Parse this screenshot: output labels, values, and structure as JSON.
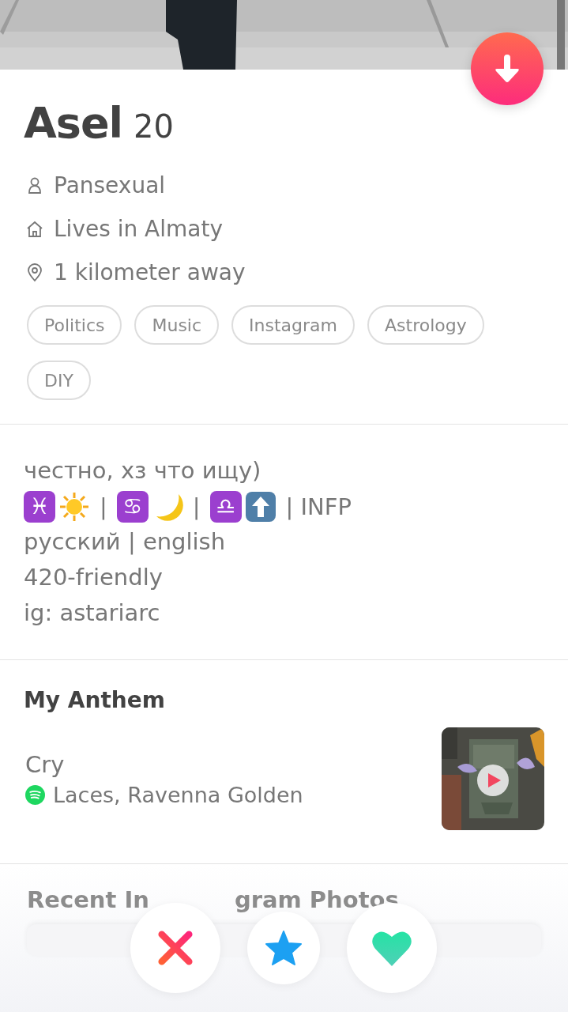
{
  "profile": {
    "name": "Asel",
    "age": "20"
  },
  "details": [
    {
      "kind": "orientation",
      "text": "Pansexual"
    },
    {
      "kind": "home",
      "text": "Lives in Almaty"
    },
    {
      "kind": "distance",
      "text": "1 kilometer away"
    }
  ],
  "interests": [
    "Politics",
    "Music",
    "Instagram",
    "Astrology",
    "DIY"
  ],
  "bio": [
    {
      "kind": "text",
      "text": "честно, хз что ищу)"
    },
    {
      "kind": "emoji_row",
      "parts": [
        {
          "kind": "sign",
          "text": "♓"
        },
        {
          "kind": "sun"
        },
        {
          "kind": "separator",
          "text": "|"
        },
        {
          "kind": "sign",
          "text": "♋"
        },
        {
          "kind": "moon"
        },
        {
          "kind": "separator",
          "text": "|"
        },
        {
          "kind": "sign",
          "text": "♎"
        },
        {
          "kind": "up_arrow"
        },
        {
          "kind": "separator",
          "text": "| INFP"
        }
      ]
    },
    {
      "kind": "text",
      "text": "русский | english"
    },
    {
      "kind": "text",
      "text": "420-friendly"
    },
    {
      "kind": "text",
      "text": "ig: astariarc"
    }
  ],
  "anthem": {
    "heading": "My Anthem",
    "song": "Cry",
    "artist": "Laces, Ravenna Golden"
  },
  "instagram": {
    "heading_parts": [
      "Recent In",
      "gram Photos"
    ]
  },
  "actions": [
    {
      "kind": "nope"
    },
    {
      "kind": "super_like"
    },
    {
      "kind": "like"
    }
  ]
}
